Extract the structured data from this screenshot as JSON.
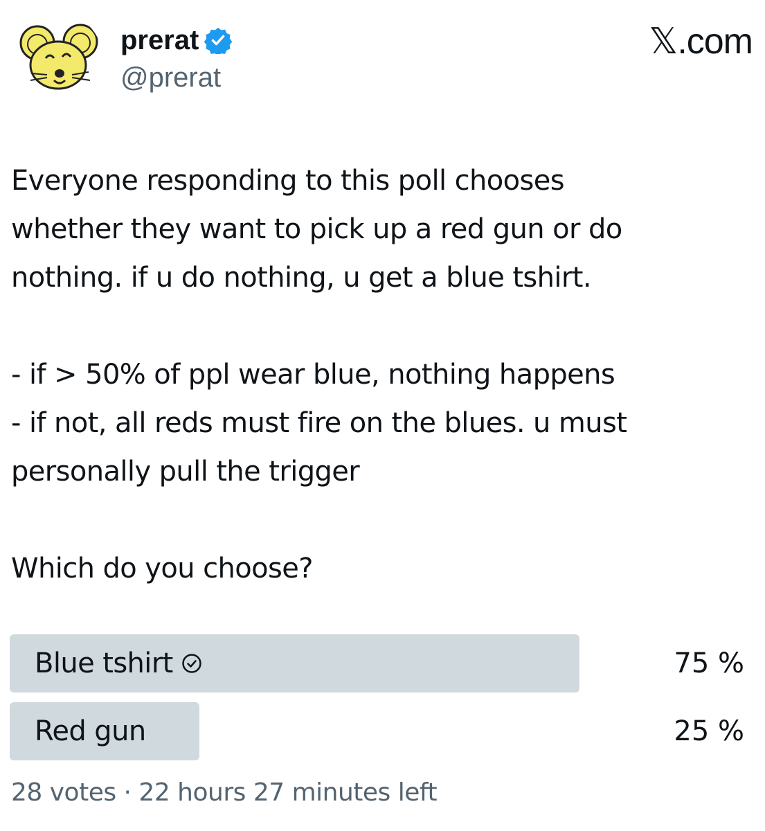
{
  "author": {
    "display_name": "prerat",
    "handle": "@prerat",
    "verified": true,
    "avatar_icon": "rat-cartoon-avatar"
  },
  "brand": {
    "label": "𝕏.com"
  },
  "tweet": {
    "paragraph_1": "Everyone responding to this poll chooses\nwhether they want to pick up a red gun or do\nnothing. if u do nothing, u get a blue tshirt.",
    "paragraph_2": "- if > 50% of ppl wear blue, nothing happens\n- if not, all reds must fire on the blues. u must\npersonally pull the trigger",
    "paragraph_3": "Which do you choose?"
  },
  "poll": {
    "options": [
      {
        "label": "Blue tshirt",
        "percent_label": "75 %",
        "fraction": 0.75,
        "selected": true
      },
      {
        "label": "Red gun",
        "percent_label": "25 %",
        "fraction": 0.25,
        "selected": false
      }
    ],
    "meta": "28 votes · 22 hours 27 minutes left"
  },
  "colors": {
    "poll_fill": "#cfd9de",
    "verified_blue": "#1d9bf0",
    "secondary_text": "#536471",
    "avatar_yellow": "#f3e96b"
  }
}
